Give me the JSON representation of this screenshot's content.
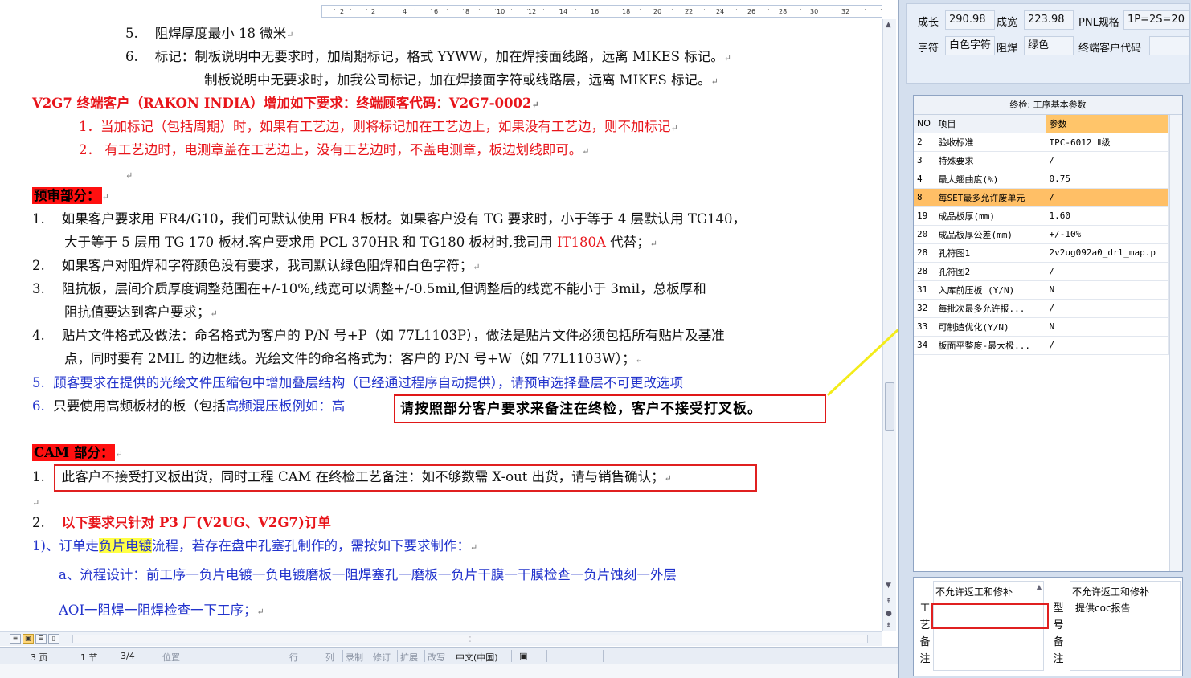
{
  "ruler": {
    "marks": [
      "2",
      "2",
      "4",
      "6",
      "8",
      "10",
      "12",
      "14",
      "16",
      "18",
      "20",
      "22",
      "24",
      "26",
      "28",
      "30",
      "32"
    ]
  },
  "doc": {
    "line5": {
      "num": "5.",
      "text": "阻焊厚度最小 18 微米"
    },
    "line6": {
      "num": "6.",
      "text": "标记：制板说明中无要求时，加周期标记，格式 YYWW，加在焊接面线路，远离 MIKES 标记。"
    },
    "line6b": "制板说明中无要求时，加我公司标记，加在焊接面字符或线路层，远离 MIKES 标记。",
    "v2g7_title": "V2G7 终端客户（RAKON INDIA）增加如下要求：终端顾客代码：V2G7-0002",
    "v2g7_1": "1．当加标记（包括周期）时，如果有工艺边，则将标记加在工艺边上，如果没有工艺边，则不加标记",
    "v2g7_2": "2． 有工艺边时，电测章盖在工艺边上，没有工艺边时，不盖电测章，板边划线即可。",
    "pre_title": "预审部分：",
    "p1_num": "1.",
    "p1a": "如果客户要求用 FR4/G10，我们可默认使用 FR4 板材。如果客户没有 TG 要求时，小于等于 4 层默认用 TG140，",
    "p1b_pre": "大于等于 5 层用 TG 170 板材.客户要求用 PCL 370HR 和 TG180 板材时,我司用 ",
    "p1b_red": "IT180A",
    "p1b_post": " 代替；",
    "p2_num": "2.",
    "p2": "如果客户对阻焊和字符颜色没有要求，我司默认绿色阻焊和白色字符；",
    "p3_num": "3.",
    "p3a": "阻抗板，层间介质厚度调整范围在+/-10%,线宽可以调整+/-0.5mil,但调整后的线宽不能小于 3mil，总板厚和",
    "p3b": "阻抗值要达到客户要求；",
    "p4_num": "4.",
    "p4a": "贴片文件格式及做法：命名格式为客户的 P/N 号+P（如 77L1103P），做法是贴片文件必须包括所有贴片及基准",
    "p4b": "点，同时要有 2MIL 的边框线。光绘文件的命名格式为：客户的  P/N 号+W（如 77L1103W）；",
    "p5_num": "5.",
    "p5": "顾客要求在提供的光绘文件压缩包中增加叠层结构（已经通过程序自动提供），请预审选择叠层不可更改选项",
    "p6_num": "6.",
    "p6_pre": "只要使用高频板材的板（包括",
    "p6_blue": "高频混压板例如：高",
    "callout": "请按照部分客户要求来备注在终检，客户不接受打叉板。",
    "cam_title": "CAM 部分：",
    "c1_num": "1.",
    "c1": "此客户不接受打叉板出货，同时工程 CAM 在终检工艺备注：如不够数需 X-out 出货，请与销售确认；",
    "c2_num": "2.",
    "c2": "以下要求只针对 P3 厂(V2UG、V2G7)订单",
    "c3_pre": "1)、订单走",
    "c3_hl": "负片电镀",
    "c3_post": "流程，若存在盘中孔塞孔制作的，需按如下要求制作：",
    "c4": "a、流程设计：前工序一负片电镀一负电镀磨板一阻焊塞孔一磨板一负片干膜一干膜检查一负片蚀刻一外层",
    "c5": "AOI一阻焊一阻焊检查一下工序；"
  },
  "status": {
    "page": "3 页",
    "section": "1 节",
    "pos": "3/4",
    "at": "位置",
    "row": "行",
    "col": "列",
    "rec": "录制",
    "rev": "修订",
    "ext": "扩展",
    "ovr": "改写",
    "lang": "中文(中国)"
  },
  "info": {
    "len_label": "成长",
    "len_value": "290.98",
    "wid_label": "成宽",
    "wid_value": "223.98",
    "pnl_label": "PNL规格",
    "pnl_value": "1P=2S=20",
    "char_label": "字符",
    "char_value": "白色字符",
    "mask_label": "阻焊",
    "mask_value": "绿色",
    "endcode_label": "终端客户代码",
    "endcode_value": ""
  },
  "grid": {
    "title": "终检: 工序基本参数",
    "headers": [
      "NO",
      "项目",
      "参数"
    ],
    "rows": [
      {
        "no": "2",
        "item": "验收标准",
        "val": "IPC-6012 Ⅱ级"
      },
      {
        "no": "3",
        "item": "特殊要求",
        "val": "/"
      },
      {
        "no": "4",
        "item": "最大翘曲度(%)",
        "val": "0.75"
      },
      {
        "no": "8",
        "item": "每SET最多允许废单元",
        "val": "/"
      },
      {
        "no": "19",
        "item": "成品板厚(mm)",
        "val": "1.60"
      },
      {
        "no": "20",
        "item": "成品板厚公差(mm)",
        "val": "+/-10%"
      },
      {
        "no": "28",
        "item": "孔符图1",
        "val": "2v2ug092a0_drl_map.p"
      },
      {
        "no": "28",
        "item": "孔符图2",
        "val": "/"
      },
      {
        "no": "31",
        "item": "入库前压板 (Y/N)",
        "val": "N"
      },
      {
        "no": "32",
        "item": "每批次最多允许报...",
        "val": "/"
      },
      {
        "no": "33",
        "item": "可制造优化(Y/N)",
        "val": "N"
      },
      {
        "no": "34",
        "item": "板面平整度-最大极...",
        "val": "/"
      }
    ]
  },
  "bottom": {
    "left_vertical": [
      "工",
      "艺",
      "备",
      "注"
    ],
    "left_note": "不允许返工和修补",
    "right_vertical": [
      "型",
      "号",
      "备",
      "注"
    ],
    "right_note1": "不允许返工和修补",
    "right_note2": "提供coc报告"
  }
}
